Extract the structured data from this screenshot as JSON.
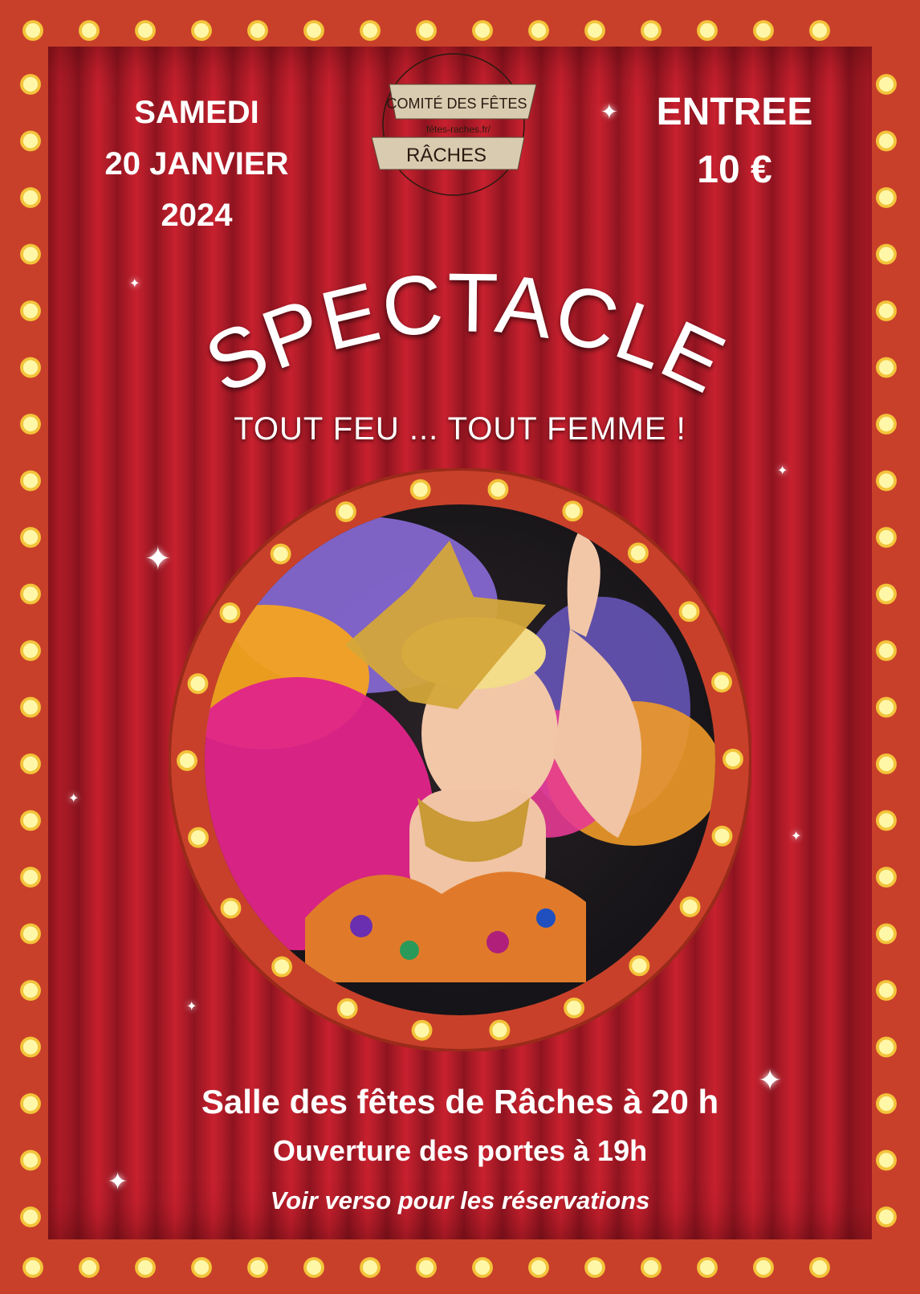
{
  "event": {
    "date_lines": [
      "SAMEDI",
      "20 JANVIER",
      "2024"
    ],
    "entry_label": "ENTREE",
    "price": "10 €",
    "title": "SPECTACLE",
    "subtitle": "TOUT FEU ... TOUT FEMME !",
    "venue": "Salle des fêtes de Râches à 20 h",
    "doors": "Ouverture des portes à 19h",
    "note": "Voir verso pour les réservations"
  },
  "logo": {
    "line1": "COMITÉ DES FÊTES",
    "url": "fêtes-raches.fr/",
    "town": "RÂCHES"
  },
  "icons": {
    "bulb": "marquee-bulb-icon",
    "sparkle": "sparkle-icon"
  },
  "colors": {
    "frame": "#c8402a",
    "curtain": "#b01c28",
    "bulb": "#fff6a0",
    "text": "#ffffff",
    "banner": "#d9cbb0"
  }
}
